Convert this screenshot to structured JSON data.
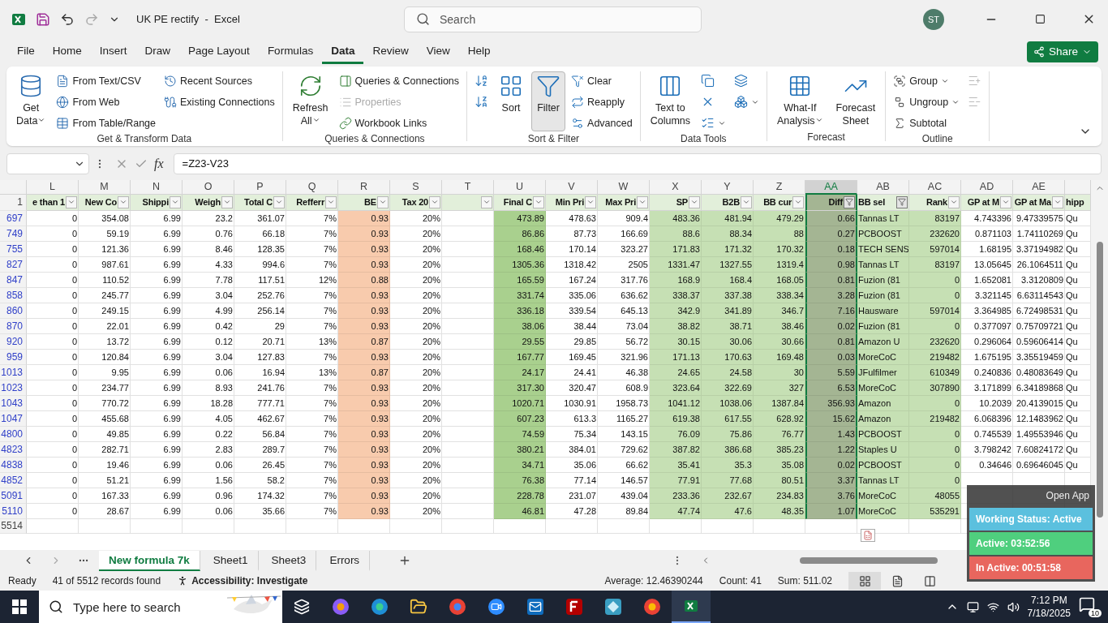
{
  "title_bar": {
    "title": "UK PE rectify  -  Excel",
    "search_placeholder": "Search",
    "avatar": "ST"
  },
  "menu": [
    {
      "label": "File",
      "selected": false
    },
    {
      "label": "Home",
      "selected": false
    },
    {
      "label": "Insert",
      "selected": false
    },
    {
      "label": "Draw",
      "selected": false
    },
    {
      "label": "Page Layout",
      "selected": false
    },
    {
      "label": "Formulas",
      "selected": false
    },
    {
      "label": "Data",
      "selected": true
    },
    {
      "label": "Review",
      "selected": false
    },
    {
      "label": "View",
      "selected": false
    },
    {
      "label": "Help",
      "selected": false
    }
  ],
  "share": "Share",
  "ribbon": [
    {
      "label": "Get & Transform Data",
      "columns": [
        [
          {
            "kind": "large",
            "lines": [
              "Get",
              "Data"
            ],
            "dropdown": true,
            "on": false,
            "disabled": false
          }
        ],
        [
          {
            "kind": "small",
            "lines": [
              "From Text/CSV"
            ],
            "dropdown": false,
            "on": false,
            "disabled": false
          },
          {
            "kind": "small",
            "lines": [
              "From Web"
            ],
            "dropdown": false,
            "on": false,
            "disabled": false
          },
          {
            "kind": "small",
            "lines": [
              "From Table/Range"
            ],
            "dropdown": false,
            "on": false,
            "disabled": false
          }
        ],
        [
          {
            "kind": "small",
            "lines": [
              "Recent Sources"
            ],
            "dropdown": false,
            "on": false,
            "disabled": false
          },
          {
            "kind": "small",
            "lines": [
              "Existing Connections"
            ],
            "dropdown": false,
            "on": false,
            "disabled": false
          }
        ]
      ]
    },
    {
      "label": "Queries & Connections",
      "columns": [
        [
          {
            "kind": "large",
            "lines": [
              "Refresh",
              "All"
            ],
            "dropdown": true,
            "on": false,
            "disabled": false
          }
        ],
        [
          {
            "kind": "small",
            "lines": [
              "Queries & Connections"
            ],
            "dropdown": false,
            "on": false,
            "disabled": false
          },
          {
            "kind": "small",
            "lines": [
              "Properties"
            ],
            "dropdown": false,
            "on": false,
            "disabled": true
          },
          {
            "kind": "small",
            "lines": [
              "Workbook Links"
            ],
            "dropdown": false,
            "on": false,
            "disabled": false
          }
        ]
      ]
    },
    {
      "label": "Sort & Filter",
      "columns": [
        [
          {
            "kind": "icon",
            "dropdown": false,
            "on": false,
            "disabled": false
          },
          {
            "kind": "icon",
            "dropdown": false,
            "on": false,
            "disabled": false
          }
        ],
        [
          {
            "kind": "large",
            "lines": [
              "Sort"
            ],
            "dropdown": false,
            "on": false,
            "disabled": false
          }
        ],
        [
          {
            "kind": "large",
            "lines": [
              "Filter"
            ],
            "dropdown": false,
            "on": true,
            "disabled": false
          }
        ],
        [
          {
            "kind": "small",
            "lines": [
              "Clear"
            ],
            "dropdown": false,
            "on": false,
            "disabled": false
          },
          {
            "kind": "small",
            "lines": [
              "Reapply"
            ],
            "dropdown": false,
            "on": false,
            "disabled": false
          },
          {
            "kind": "small",
            "lines": [
              "Advanced"
            ],
            "dropdown": false,
            "on": false,
            "disabled": false
          }
        ]
      ]
    },
    {
      "label": "Data Tools",
      "columns": [
        [
          {
            "kind": "large",
            "lines": [
              "Text to",
              "Columns"
            ],
            "dropdown": false,
            "on": false,
            "disabled": false
          }
        ],
        [
          {
            "kind": "icon",
            "dropdown": false,
            "on": false,
            "disabled": false
          },
          {
            "kind": "icon",
            "dropdown": false,
            "on": false,
            "disabled": false
          },
          {
            "kind": "icon",
            "dropdown": true,
            "on": false,
            "disabled": false
          }
        ],
        [
          {
            "kind": "icon",
            "dropdown": false,
            "on": false,
            "disabled": false
          },
          {
            "kind": "icon",
            "dropdown": true,
            "on": false,
            "disabled": false
          }
        ]
      ]
    },
    {
      "label": "Forecast",
      "columns": [
        [
          {
            "kind": "large",
            "lines": [
              "What-If",
              "Analysis"
            ],
            "dropdown": true,
            "on": false,
            "disabled": false
          }
        ],
        [
          {
            "kind": "large",
            "lines": [
              "Forecast",
              "Sheet"
            ],
            "dropdown": false,
            "on": false,
            "disabled": false
          }
        ]
      ]
    },
    {
      "label": "Outline",
      "columns": [
        [
          {
            "kind": "small",
            "lines": [
              "Group"
            ],
            "dropdown": true,
            "on": false,
            "disabled": false
          },
          {
            "kind": "small",
            "lines": [
              "Ungroup"
            ],
            "dropdown": true,
            "on": false,
            "disabled": false
          },
          {
            "kind": "small",
            "lines": [
              "Subtotal"
            ],
            "dropdown": false,
            "on": false,
            "disabled": false
          }
        ],
        [
          {
            "kind": "icon",
            "dropdown": false,
            "on": false,
            "disabled": true
          },
          {
            "kind": "icon",
            "dropdown": false,
            "on": false,
            "disabled": true
          }
        ]
      ]
    }
  ],
  "formula_bar": {
    "fx": "fx",
    "formula": "=Z23-V23"
  },
  "sheet": {
    "columns": [
      {
        "letter": "L",
        "header": "e than 1",
        "color": "#ffffff",
        "kind": "number",
        "selected": false,
        "filtered": false
      },
      {
        "letter": "M",
        "header": "New Co",
        "color": "#ffffff",
        "kind": "number",
        "selected": false,
        "filtered": false
      },
      {
        "letter": "N",
        "header": "Shippi",
        "color": "#ffffff",
        "kind": "number",
        "selected": false,
        "filtered": false
      },
      {
        "letter": "O",
        "header": "Weigh",
        "color": "#ffffff",
        "kind": "number",
        "selected": false,
        "filtered": false
      },
      {
        "letter": "P",
        "header": "Total C",
        "color": "#ffffff",
        "kind": "number",
        "selected": false,
        "filtered": false
      },
      {
        "letter": "Q",
        "header": "Refferr",
        "color": "#ffffff",
        "kind": "number",
        "selected": false,
        "filtered": false
      },
      {
        "letter": "R",
        "header": "BE",
        "color": "#f8cbad",
        "kind": "number",
        "selected": false,
        "filtered": false
      },
      {
        "letter": "S",
        "header": "Tax 20",
        "color": "#ffffff",
        "kind": "number",
        "selected": false,
        "filtered": false
      },
      {
        "letter": "T",
        "color": "#ffffff",
        "kind": "number",
        "selected": false,
        "filtered": false
      },
      {
        "letter": "U",
        "header": "Final C",
        "color": "#a9d08e",
        "kind": "number",
        "selected": false,
        "filtered": false
      },
      {
        "letter": "V",
        "header": "Min Pri",
        "color": "#ffffff",
        "kind": "number",
        "selected": false,
        "filtered": false
      },
      {
        "letter": "W",
        "header": "Max Pri",
        "color": "#ffffff",
        "kind": "number",
        "selected": false,
        "filtered": false
      },
      {
        "letter": "X",
        "header": "SP",
        "color": "#c6e0b4",
        "kind": "number",
        "selected": false,
        "filtered": false
      },
      {
        "letter": "Y",
        "header": "B2B",
        "color": "#c6e0b4",
        "kind": "number",
        "selected": false,
        "filtered": false
      },
      {
        "letter": "Z",
        "header": "BB cur",
        "color": "#c6e0b4",
        "kind": "number",
        "selected": false,
        "filtered": false
      },
      {
        "letter": "AA",
        "header": "Diff",
        "color": "#a4b593",
        "kind": "number",
        "selected": true,
        "filtered": true
      },
      {
        "letter": "AB",
        "header": "BB sel",
        "color": "#c6e0b4",
        "kind": "text",
        "selected": false,
        "filtered": true
      },
      {
        "letter": "AC",
        "header": "Rank",
        "color": "#c6e0b4",
        "kind": "number",
        "selected": false,
        "filtered": false
      },
      {
        "letter": "AD",
        "header": "GP at M",
        "color": "#ffffff",
        "kind": "number",
        "selected": false,
        "filtered": false
      },
      {
        "letter": "AE",
        "header": "GP at Ma",
        "color": "#ffffff",
        "kind": "number",
        "selected": false,
        "filtered": false
      },
      {
        "header": "hipp",
        "color": "#ffffff",
        "kind": "text",
        "selected": false
      }
    ],
    "header_row": "1",
    "rows": [
      {
        "number": "697",
        "cells": [
          "0",
          "354.08",
          "6.99",
          "23.2",
          "361.07",
          "7%",
          "0.93",
          "20%",
          null,
          "473.89",
          "478.63",
          "909.4",
          "483.36",
          "481.94",
          "479.29",
          "0.66",
          "Tannas LT",
          "83197",
          "4.743396",
          "9.47339575",
          "Qu"
        ]
      },
      {
        "number": "749",
        "cells": [
          "0",
          "59.19",
          "6.99",
          "0.76",
          "66.18",
          "7%",
          "0.93",
          "20%",
          null,
          "86.86",
          "87.73",
          "166.69",
          "88.6",
          "88.34",
          "88",
          "0.27",
          "PCBOOST",
          "232620",
          "0.871103",
          "1.74110269",
          "Qu"
        ]
      },
      {
        "number": "755",
        "cells": [
          "0",
          "121.36",
          "6.99",
          "8.46",
          "128.35",
          "7%",
          "0.93",
          "20%",
          null,
          "168.46",
          "170.14",
          "323.27",
          "171.83",
          "171.32",
          "170.32",
          "0.18",
          "TECH SENS",
          "597014",
          "1.68195",
          "3.37194982",
          "Qu"
        ]
      },
      {
        "number": "827",
        "cells": [
          "0",
          "987.61",
          "6.99",
          "4.33",
          "994.6",
          "7%",
          "0.93",
          "20%",
          null,
          "1305.36",
          "1318.42",
          "2505",
          "1331.47",
          "1327.55",
          "1319.4",
          "0.98",
          "Tannas LT",
          "83197",
          "13.05645",
          "26.1064511",
          "Qu"
        ]
      },
      {
        "number": "847",
        "cells": [
          "0",
          "110.52",
          "6.99",
          "7.78",
          "117.51",
          "12%",
          "0.88",
          "20%",
          null,
          "165.59",
          "167.24",
          "317.76",
          "168.9",
          "168.4",
          "168.05",
          "0.81",
          "Fuzion (81",
          "0",
          "1.652081",
          "3.3120809",
          "Qu"
        ]
      },
      {
        "number": "858",
        "cells": [
          "0",
          "245.77",
          "6.99",
          "3.04",
          "252.76",
          "7%",
          "0.93",
          "20%",
          null,
          "331.74",
          "335.06",
          "636.62",
          "338.37",
          "337.38",
          "338.34",
          "3.28",
          "Fuzion (81",
          "0",
          "3.321145",
          "6.63114543",
          "Qu"
        ]
      },
      {
        "number": "860",
        "cells": [
          "0",
          "249.15",
          "6.99",
          "4.99",
          "256.14",
          "7%",
          "0.93",
          "20%",
          null,
          "336.18",
          "339.54",
          "645.13",
          "342.9",
          "341.89",
          "346.7",
          "7.16",
          "Hausware",
          "597014",
          "3.364985",
          "6.72498531",
          "Qu"
        ]
      },
      {
        "number": "870",
        "cells": [
          "0",
          "22.01",
          "6.99",
          "0.42",
          "29",
          "7%",
          "0.93",
          "20%",
          null,
          "38.06",
          "38.44",
          "73.04",
          "38.82",
          "38.71",
          "38.46",
          "0.02",
          "Fuzion (81",
          "0",
          "0.377097",
          "0.75709721",
          "Qu"
        ]
      },
      {
        "number": "920",
        "cells": [
          "0",
          "13.72",
          "6.99",
          "0.12",
          "20.71",
          "13%",
          "0.87",
          "20%",
          null,
          "29.55",
          "29.85",
          "56.72",
          "30.15",
          "30.06",
          "30.66",
          "0.81",
          "Amazon U",
          "232620",
          "0.296064",
          "0.59606414",
          "Qu"
        ]
      },
      {
        "number": "959",
        "cells": [
          "0",
          "120.84",
          "6.99",
          "3.04",
          "127.83",
          "7%",
          "0.93",
          "20%",
          null,
          "167.77",
          "169.45",
          "321.96",
          "171.13",
          "170.63",
          "169.48",
          "0.03",
          "MoreCoC",
          "219482",
          "1.675195",
          "3.35519459",
          "Qu"
        ]
      },
      {
        "number": "1013",
        "cells": [
          "0",
          "9.95",
          "6.99",
          "0.06",
          "16.94",
          "13%",
          "0.87",
          "20%",
          null,
          "24.17",
          "24.41",
          "46.38",
          "24.65",
          "24.58",
          "30",
          "5.59",
          "JFulfilmer",
          "610349",
          "0.240836",
          "0.48083649",
          "Qu"
        ]
      },
      {
        "number": "1023",
        "cells": [
          "0",
          "234.77",
          "6.99",
          "8.93",
          "241.76",
          "7%",
          "0.93",
          "20%",
          null,
          "317.30",
          "320.47",
          "608.9",
          "323.64",
          "322.69",
          "327",
          "6.53",
          "MoreCoC",
          "307890",
          "3.171899",
          "6.34189868",
          "Qu"
        ]
      },
      {
        "number": "1043",
        "cells": [
          "0",
          "770.72",
          "6.99",
          "18.28",
          "777.71",
          "7%",
          "0.93",
          "20%",
          null,
          "1020.71",
          "1030.91",
          "1958.73",
          "1041.12",
          "1038.06",
          "1387.84",
          "356.93",
          "Amazon",
          "0",
          "10.2039",
          "20.4139015",
          "Qu"
        ]
      },
      {
        "number": "1047",
        "cells": [
          "0",
          "455.68",
          "6.99",
          "4.05",
          "462.67",
          "7%",
          "0.93",
          "20%",
          null,
          "607.23",
          "613.3",
          "1165.27",
          "619.38",
          "617.55",
          "628.92",
          "15.62",
          "Amazon",
          "219482",
          "6.068396",
          "12.1483962",
          "Qu"
        ]
      },
      {
        "number": "4800",
        "cells": [
          "0",
          "49.85",
          "6.99",
          "0.22",
          "56.84",
          "7%",
          "0.93",
          "20%",
          null,
          "74.59",
          "75.34",
          "143.15",
          "76.09",
          "75.86",
          "76.77",
          "1.43",
          "PCBOOST",
          "0",
          "0.745539",
          "1.49553946",
          "Qu"
        ]
      },
      {
        "number": "4823",
        "cells": [
          "0",
          "282.71",
          "6.99",
          "2.83",
          "289.7",
          "7%",
          "0.93",
          "20%",
          null,
          "380.21",
          "384.01",
          "729.62",
          "387.82",
          "386.68",
          "385.23",
          "1.22",
          "Staples U",
          "0",
          "3.798242",
          "7.60824172",
          "Qu"
        ]
      },
      {
        "number": "4838",
        "cells": [
          "0",
          "19.46",
          "6.99",
          "0.06",
          "26.45",
          "7%",
          "0.93",
          "20%",
          null,
          "34.71",
          "35.06",
          "66.62",
          "35.41",
          "35.3",
          "35.08",
          "0.02",
          "PCBOOST",
          "0",
          "0.34646",
          "0.69646045",
          "Qu"
        ]
      },
      {
        "number": "4852",
        "cells": [
          "0",
          "51.21",
          "6.99",
          "1.56",
          "58.2",
          "7%",
          "0.93",
          "20%",
          null,
          "76.38",
          "77.14",
          "146.57",
          "77.91",
          "77.68",
          "80.51",
          "3.37",
          "Tannas LT",
          "0",
          null,
          null,
          null
        ]
      },
      {
        "number": "5091",
        "cells": [
          "0",
          "167.33",
          "6.99",
          "0.96",
          "174.32",
          "7%",
          "0.93",
          "20%",
          null,
          "228.78",
          "231.07",
          "439.04",
          "233.36",
          "232.67",
          "234.83",
          "3.76",
          "MoreCoC",
          "48055",
          null,
          null,
          null
        ]
      },
      {
        "number": "5110",
        "cells": [
          "0",
          "28.67",
          "6.99",
          "0.06",
          "35.66",
          "7%",
          "0.93",
          "20%",
          null,
          "46.81",
          "47.28",
          "89.84",
          "47.74",
          "47.6",
          "48.35",
          "1.07",
          "MoreCoC",
          "535291",
          null,
          null,
          null
        ]
      }
    ],
    "empty_row": "5514"
  },
  "sheet_tabs": [
    {
      "label": "New formula 7k",
      "selected": true
    },
    {
      "label": "Sheet1",
      "selected": false
    },
    {
      "label": "Sheet3",
      "selected": false
    },
    {
      "label": "Errors",
      "selected": false
    }
  ],
  "status_bar": {
    "mode": "Ready",
    "records": "41 of 5512 records found",
    "accessibility": "Accessibility: Investigate",
    "average": "Average: 12.46390244",
    "count": "Count: 41",
    "sum": "Sum: 511.02",
    "views": [
      {
        "selected": true
      },
      {
        "selected": false
      },
      {
        "selected": false
      }
    ]
  },
  "tracker": {
    "link": "Open App",
    "statuses": [
      {
        "label": "Working Status: Active",
        "color": "#5bc0de"
      },
      {
        "label": "Active: 03:52:56",
        "color": "#4fcf7e"
      },
      {
        "label": "In Active: 00:51:58",
        "color": "#e8665e"
      }
    ]
  },
  "taskbar": {
    "search_placeholder": "Type here to search",
    "time": "7:12 PM",
    "date": "7/18/2025",
    "notifications": "10"
  }
}
